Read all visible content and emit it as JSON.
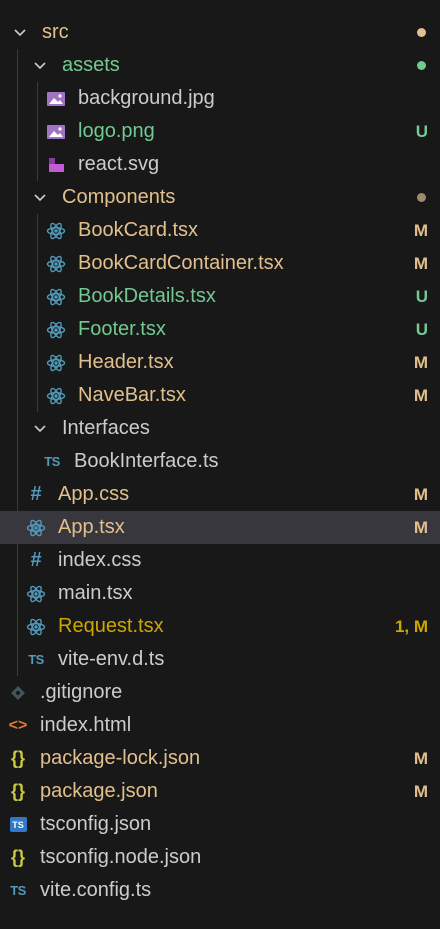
{
  "explorer": {
    "items": [
      {
        "label": "src",
        "kind": "folder"
      },
      {
        "label": "assets",
        "kind": "folder"
      },
      {
        "label": "background.jpg",
        "kind": "image"
      },
      {
        "label": "logo.png",
        "kind": "image",
        "status": "U"
      },
      {
        "label": "react.svg",
        "kind": "svg"
      },
      {
        "label": "Components",
        "kind": "folder"
      },
      {
        "label": "BookCard.tsx",
        "kind": "react",
        "status": "M"
      },
      {
        "label": "BookCardContainer.tsx",
        "kind": "react",
        "status": "M"
      },
      {
        "label": "BookDetails.tsx",
        "kind": "react",
        "status": "U"
      },
      {
        "label": "Footer.tsx",
        "kind": "react",
        "status": "U"
      },
      {
        "label": "Header.tsx",
        "kind": "react",
        "status": "M"
      },
      {
        "label": "NaveBar.tsx",
        "kind": "react",
        "status": "M"
      },
      {
        "label": "Interfaces",
        "kind": "folder"
      },
      {
        "label": "BookInterface.ts",
        "kind": "ts"
      },
      {
        "label": "App.css",
        "kind": "css",
        "status": "M"
      },
      {
        "label": "App.tsx",
        "kind": "react",
        "status": "M"
      },
      {
        "label": "index.css",
        "kind": "css"
      },
      {
        "label": "main.tsx",
        "kind": "react"
      },
      {
        "label": "Request.tsx",
        "kind": "react",
        "status": "1, M"
      },
      {
        "label": "vite-env.d.ts",
        "kind": "ts"
      },
      {
        "label": ".gitignore",
        "kind": "git"
      },
      {
        "label": "index.html",
        "kind": "html"
      },
      {
        "label": "package-lock.json",
        "kind": "json",
        "status": "M"
      },
      {
        "label": "package.json",
        "kind": "json",
        "status": "M"
      },
      {
        "label": "tsconfig.json",
        "kind": "tsconfig"
      },
      {
        "label": "tsconfig.node.json",
        "kind": "json"
      },
      {
        "label": "vite.config.ts",
        "kind": "ts"
      }
    ]
  },
  "colors": {
    "background": "#181818",
    "selected_row": "#37373d",
    "modified": "#e2c08d",
    "untracked": "#73c991",
    "default_text": "#cccccc"
  }
}
